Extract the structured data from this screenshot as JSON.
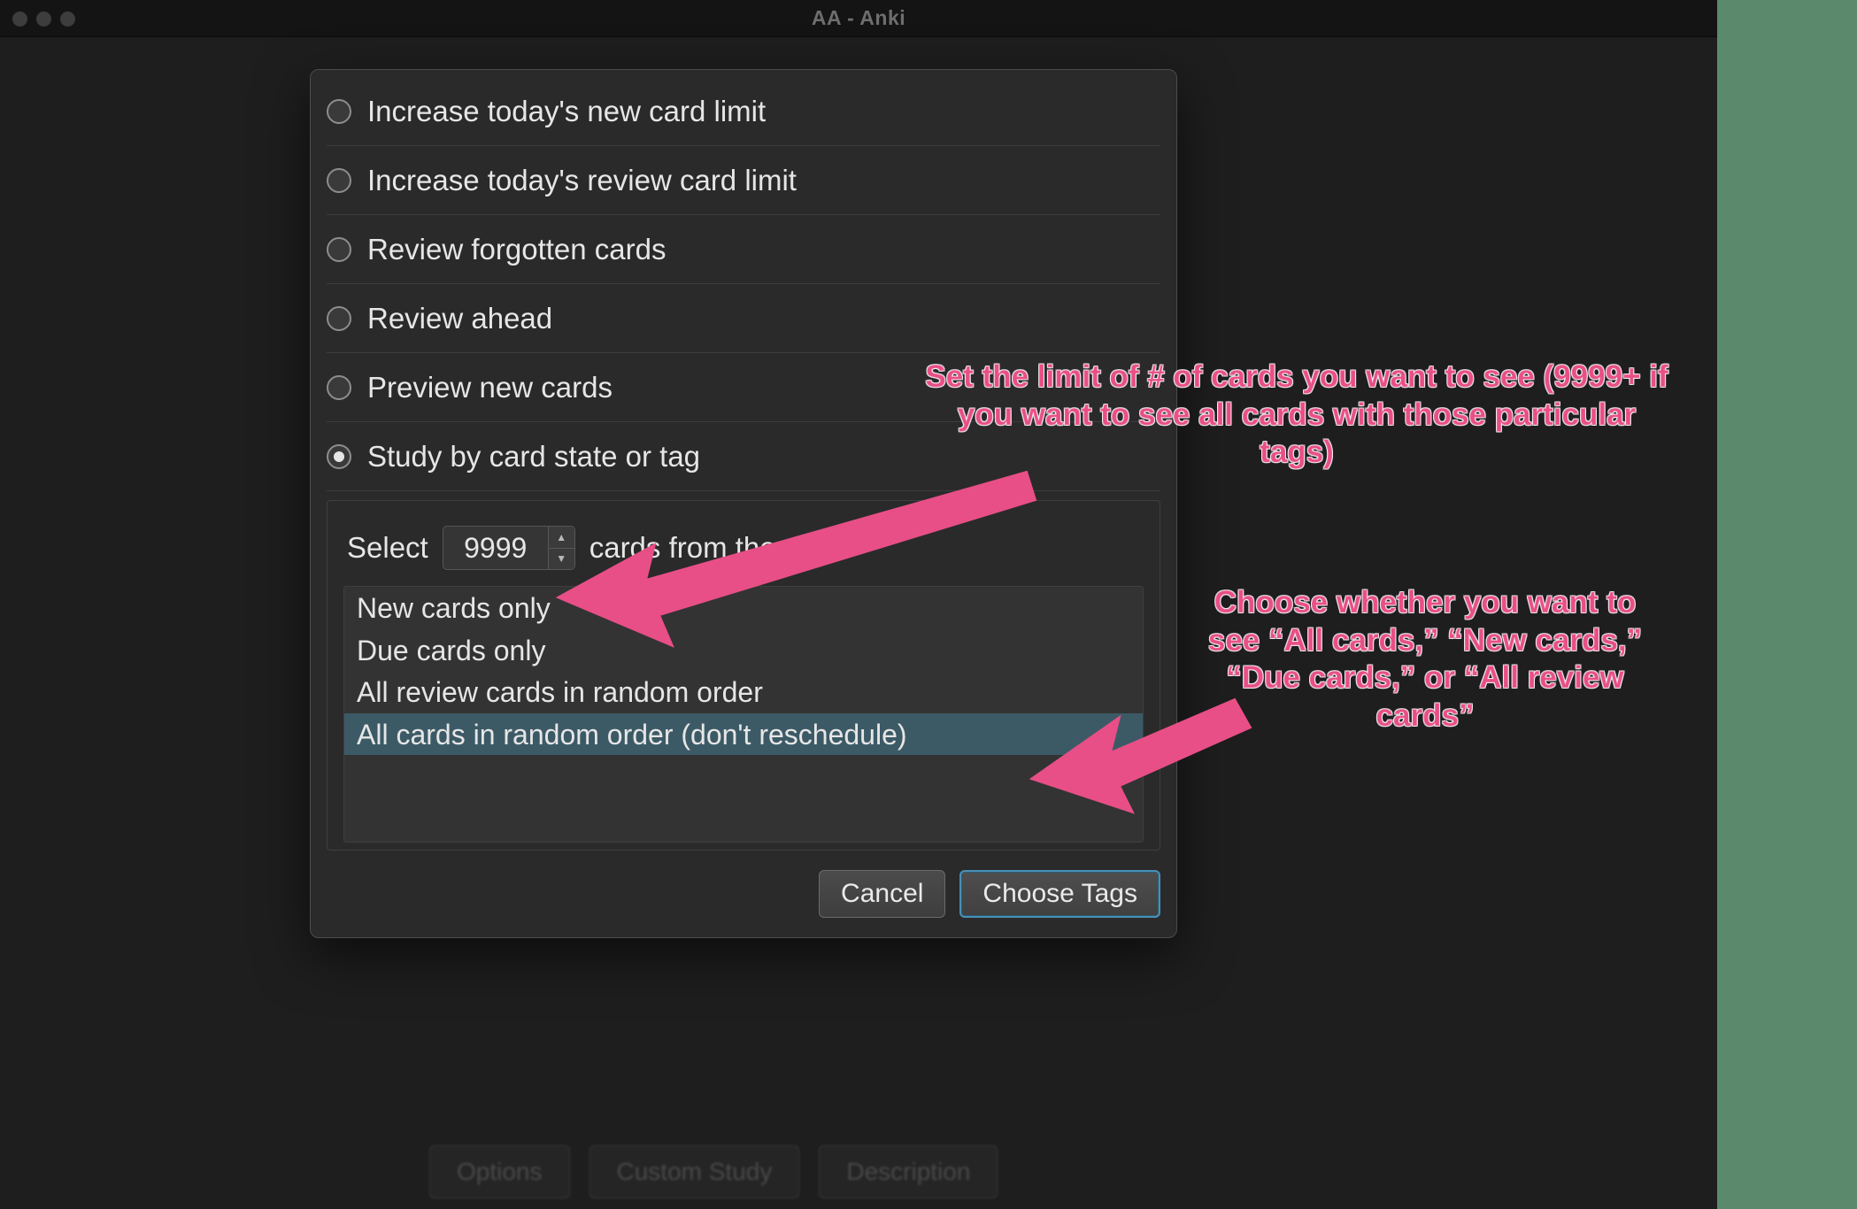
{
  "window_title": "AA - Anki",
  "radios": [
    {
      "label": "Increase today's new card limit",
      "checked": false
    },
    {
      "label": "Increase today's review card limit",
      "checked": false
    },
    {
      "label": "Review forgotten cards",
      "checked": false
    },
    {
      "label": "Review ahead",
      "checked": false
    },
    {
      "label": "Preview new cards",
      "checked": false
    },
    {
      "label": "Study by card state or tag",
      "checked": true
    }
  ],
  "select_row": {
    "prefix": "Select",
    "count_value": "9999",
    "suffix": "cards from the deck"
  },
  "list_options": [
    {
      "label": "New cards only",
      "selected": false
    },
    {
      "label": "Due cards only",
      "selected": false
    },
    {
      "label": "All review cards in random order",
      "selected": false
    },
    {
      "label": "All cards in random order (don't reschedule)",
      "selected": true
    }
  ],
  "footer": {
    "cancel": "Cancel",
    "choose_tags": "Choose Tags"
  },
  "underlying_buttons": [
    "Options",
    "Custom Study",
    "Description"
  ],
  "annotations": {
    "a1": "Set the limit of # of cards you want to see (9999+ if you want to see all cards with those particular tags)",
    "a2": "Choose whether you want to see “All cards,” “New cards,” “Due cards,” or “All review cards”"
  }
}
